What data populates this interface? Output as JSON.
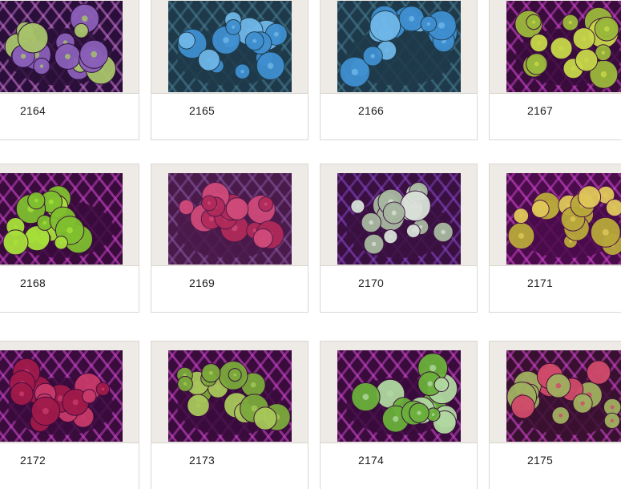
{
  "items": [
    {
      "label": "2164",
      "thumbnail": "purple mushroom coral on pink lit grid",
      "palette": [
        "#8a5fb8",
        "#a8c46a",
        "#2a0f3a",
        "#d07ad8"
      ]
    },
    {
      "label": "2165",
      "thumbnail": "blue mushroom coral",
      "palette": [
        "#3f8fd0",
        "#6fb7e8",
        "#1e3a4a",
        "#4b7f96"
      ]
    },
    {
      "label": "2166",
      "thumbnail": "blue mushroom coral",
      "palette": [
        "#3f8fd0",
        "#6fb7e8",
        "#1e3a4a",
        "#4b7f96"
      ]
    },
    {
      "label": "2167",
      "thumbnail": "green-yellow mushroom coral on pink lit grid",
      "palette": [
        "#9ab83a",
        "#c7d84a",
        "#3a0c3c",
        "#d94ad8"
      ]
    },
    {
      "label": "2168",
      "thumbnail": "green mushroom coral on pink lit grid",
      "palette": [
        "#7fbf2f",
        "#a8e03a",
        "#3a0c3c",
        "#d94ad8"
      ]
    },
    {
      "label": "2169",
      "thumbnail": "red-magenta mushroom coral",
      "palette": [
        "#b02a5a",
        "#d04a7a",
        "#4a1a4a",
        "#8a5aa8"
      ]
    },
    {
      "label": "2170",
      "thumbnail": "white-green mushroom coral",
      "palette": [
        "#a8b8a0",
        "#d8e0d8",
        "#3a1040",
        "#8a4ad0"
      ]
    },
    {
      "label": "2171",
      "thumbnail": "yellow striped mushroom coral",
      "palette": [
        "#b8a83a",
        "#e0c85a",
        "#4a0c4a",
        "#d94ad8"
      ]
    },
    {
      "label": "2172",
      "thumbnail": "dark red mushroom coral",
      "palette": [
        "#a01a4a",
        "#c83a6a",
        "#3a0c3c",
        "#d94ad8"
      ]
    },
    {
      "label": "2173",
      "thumbnail": "green mushroom coral",
      "palette": [
        "#7aa83a",
        "#a8c85a",
        "#3a0c3c",
        "#d94ad8"
      ]
    },
    {
      "label": "2174",
      "thumbnail": "green-white mushroom coral",
      "palette": [
        "#6ab03a",
        "#b0d8a0",
        "#3a0c3c",
        "#d94ad8"
      ]
    },
    {
      "label": "2175",
      "thumbnail": "green mushroom coral with red rims",
      "palette": [
        "#a0b060",
        "#d04a6a",
        "#3a1030",
        "#d94ad8"
      ]
    }
  ]
}
